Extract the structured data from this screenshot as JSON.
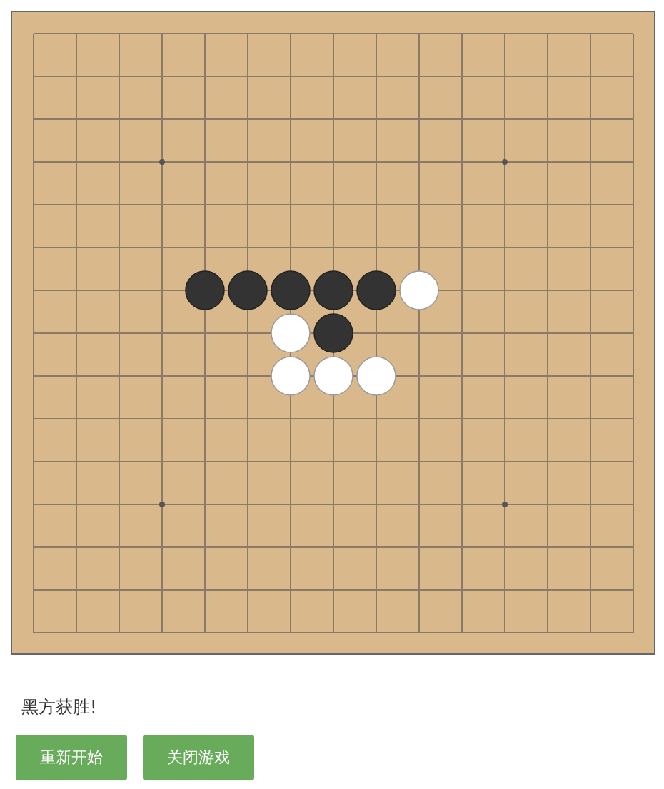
{
  "board": {
    "rows": [
      {
        "cells": [
          {
            "kind": "empty"
          },
          {
            "kind": "empty"
          },
          {
            "kind": "empty"
          },
          {
            "kind": "empty"
          },
          {
            "kind": "empty"
          },
          {
            "kind": "empty"
          },
          {
            "kind": "empty"
          },
          {
            "kind": "empty"
          },
          {
            "kind": "empty"
          },
          {
            "kind": "empty"
          },
          {
            "kind": "empty"
          },
          {
            "kind": "empty"
          },
          {
            "kind": "empty"
          },
          {
            "kind": "empty"
          },
          {
            "kind": "empty"
          }
        ]
      },
      {
        "cells": [
          {
            "kind": "empty"
          },
          {
            "kind": "empty"
          },
          {
            "kind": "empty"
          },
          {
            "kind": "empty"
          },
          {
            "kind": "empty"
          },
          {
            "kind": "empty"
          },
          {
            "kind": "empty"
          },
          {
            "kind": "empty"
          },
          {
            "kind": "empty"
          },
          {
            "kind": "empty"
          },
          {
            "kind": "empty"
          },
          {
            "kind": "empty"
          },
          {
            "kind": "empty"
          },
          {
            "kind": "empty"
          },
          {
            "kind": "empty"
          }
        ]
      },
      {
        "cells": [
          {
            "kind": "empty"
          },
          {
            "kind": "empty"
          },
          {
            "kind": "empty"
          },
          {
            "kind": "empty"
          },
          {
            "kind": "empty"
          },
          {
            "kind": "empty"
          },
          {
            "kind": "empty"
          },
          {
            "kind": "empty"
          },
          {
            "kind": "empty"
          },
          {
            "kind": "empty"
          },
          {
            "kind": "empty"
          },
          {
            "kind": "empty"
          },
          {
            "kind": "empty"
          },
          {
            "kind": "empty"
          },
          {
            "kind": "empty"
          }
        ]
      },
      {
        "cells": [
          {
            "kind": "empty"
          },
          {
            "kind": "empty"
          },
          {
            "kind": "empty"
          },
          {
            "kind": "star"
          },
          {
            "kind": "empty"
          },
          {
            "kind": "empty"
          },
          {
            "kind": "empty"
          },
          {
            "kind": "empty"
          },
          {
            "kind": "empty"
          },
          {
            "kind": "empty"
          },
          {
            "kind": "empty"
          },
          {
            "kind": "star"
          },
          {
            "kind": "empty"
          },
          {
            "kind": "empty"
          },
          {
            "kind": "empty"
          }
        ]
      },
      {
        "cells": [
          {
            "kind": "empty"
          },
          {
            "kind": "empty"
          },
          {
            "kind": "empty"
          },
          {
            "kind": "empty"
          },
          {
            "kind": "empty"
          },
          {
            "kind": "empty"
          },
          {
            "kind": "empty"
          },
          {
            "kind": "empty"
          },
          {
            "kind": "empty"
          },
          {
            "kind": "empty"
          },
          {
            "kind": "empty"
          },
          {
            "kind": "empty"
          },
          {
            "kind": "empty"
          },
          {
            "kind": "empty"
          },
          {
            "kind": "empty"
          }
        ]
      },
      {
        "cells": [
          {
            "kind": "empty"
          },
          {
            "kind": "empty"
          },
          {
            "kind": "empty"
          },
          {
            "kind": "empty"
          },
          {
            "kind": "empty"
          },
          {
            "kind": "empty"
          },
          {
            "kind": "empty"
          },
          {
            "kind": "empty"
          },
          {
            "kind": "empty"
          },
          {
            "kind": "empty"
          },
          {
            "kind": "empty"
          },
          {
            "kind": "empty"
          },
          {
            "kind": "empty"
          },
          {
            "kind": "empty"
          },
          {
            "kind": "empty"
          }
        ]
      },
      {
        "cells": [
          {
            "kind": "empty"
          },
          {
            "kind": "empty"
          },
          {
            "kind": "empty"
          },
          {
            "kind": "empty"
          },
          {
            "kind": "black"
          },
          {
            "kind": "black"
          },
          {
            "kind": "black"
          },
          {
            "kind": "black"
          },
          {
            "kind": "black"
          },
          {
            "kind": "white"
          },
          {
            "kind": "empty"
          },
          {
            "kind": "empty"
          },
          {
            "kind": "empty"
          },
          {
            "kind": "empty"
          },
          {
            "kind": "empty"
          }
        ]
      },
      {
        "cells": [
          {
            "kind": "empty"
          },
          {
            "kind": "empty"
          },
          {
            "kind": "empty"
          },
          {
            "kind": "empty"
          },
          {
            "kind": "empty"
          },
          {
            "kind": "empty"
          },
          {
            "kind": "white"
          },
          {
            "kind": "black"
          },
          {
            "kind": "empty"
          },
          {
            "kind": "empty"
          },
          {
            "kind": "empty"
          },
          {
            "kind": "empty"
          },
          {
            "kind": "empty"
          },
          {
            "kind": "empty"
          },
          {
            "kind": "empty"
          }
        ]
      },
      {
        "cells": [
          {
            "kind": "empty"
          },
          {
            "kind": "empty"
          },
          {
            "kind": "empty"
          },
          {
            "kind": "empty"
          },
          {
            "kind": "empty"
          },
          {
            "kind": "empty"
          },
          {
            "kind": "white"
          },
          {
            "kind": "white"
          },
          {
            "kind": "white"
          },
          {
            "kind": "empty"
          },
          {
            "kind": "empty"
          },
          {
            "kind": "empty"
          },
          {
            "kind": "empty"
          },
          {
            "kind": "empty"
          },
          {
            "kind": "empty"
          }
        ]
      },
      {
        "cells": [
          {
            "kind": "empty"
          },
          {
            "kind": "empty"
          },
          {
            "kind": "empty"
          },
          {
            "kind": "empty"
          },
          {
            "kind": "empty"
          },
          {
            "kind": "empty"
          },
          {
            "kind": "empty"
          },
          {
            "kind": "empty"
          },
          {
            "kind": "empty"
          },
          {
            "kind": "empty"
          },
          {
            "kind": "empty"
          },
          {
            "kind": "empty"
          },
          {
            "kind": "empty"
          },
          {
            "kind": "empty"
          },
          {
            "kind": "empty"
          }
        ]
      },
      {
        "cells": [
          {
            "kind": "empty"
          },
          {
            "kind": "empty"
          },
          {
            "kind": "empty"
          },
          {
            "kind": "empty"
          },
          {
            "kind": "empty"
          },
          {
            "kind": "empty"
          },
          {
            "kind": "empty"
          },
          {
            "kind": "empty"
          },
          {
            "kind": "empty"
          },
          {
            "kind": "empty"
          },
          {
            "kind": "empty"
          },
          {
            "kind": "empty"
          },
          {
            "kind": "empty"
          },
          {
            "kind": "empty"
          },
          {
            "kind": "empty"
          }
        ]
      },
      {
        "cells": [
          {
            "kind": "empty"
          },
          {
            "kind": "empty"
          },
          {
            "kind": "empty"
          },
          {
            "kind": "star"
          },
          {
            "kind": "empty"
          },
          {
            "kind": "empty"
          },
          {
            "kind": "empty"
          },
          {
            "kind": "empty"
          },
          {
            "kind": "empty"
          },
          {
            "kind": "empty"
          },
          {
            "kind": "empty"
          },
          {
            "kind": "star"
          },
          {
            "kind": "empty"
          },
          {
            "kind": "empty"
          },
          {
            "kind": "empty"
          }
        ]
      },
      {
        "cells": [
          {
            "kind": "empty"
          },
          {
            "kind": "empty"
          },
          {
            "kind": "empty"
          },
          {
            "kind": "empty"
          },
          {
            "kind": "empty"
          },
          {
            "kind": "empty"
          },
          {
            "kind": "empty"
          },
          {
            "kind": "empty"
          },
          {
            "kind": "empty"
          },
          {
            "kind": "empty"
          },
          {
            "kind": "empty"
          },
          {
            "kind": "empty"
          },
          {
            "kind": "empty"
          },
          {
            "kind": "empty"
          },
          {
            "kind": "empty"
          }
        ]
      },
      {
        "cells": [
          {
            "kind": "empty"
          },
          {
            "kind": "empty"
          },
          {
            "kind": "empty"
          },
          {
            "kind": "empty"
          },
          {
            "kind": "empty"
          },
          {
            "kind": "empty"
          },
          {
            "kind": "empty"
          },
          {
            "kind": "empty"
          },
          {
            "kind": "empty"
          },
          {
            "kind": "empty"
          },
          {
            "kind": "empty"
          },
          {
            "kind": "empty"
          },
          {
            "kind": "empty"
          },
          {
            "kind": "empty"
          },
          {
            "kind": "empty"
          }
        ]
      },
      {
        "cells": [
          {
            "kind": "empty"
          },
          {
            "kind": "empty"
          },
          {
            "kind": "empty"
          },
          {
            "kind": "empty"
          },
          {
            "kind": "empty"
          },
          {
            "kind": "empty"
          },
          {
            "kind": "empty"
          },
          {
            "kind": "empty"
          },
          {
            "kind": "empty"
          },
          {
            "kind": "empty"
          },
          {
            "kind": "empty"
          },
          {
            "kind": "empty"
          },
          {
            "kind": "empty"
          },
          {
            "kind": "empty"
          },
          {
            "kind": "empty"
          }
        ]
      }
    ]
  },
  "status": "黑方获胜!",
  "buttons": [
    "重新开始",
    "关闭游戏"
  ]
}
